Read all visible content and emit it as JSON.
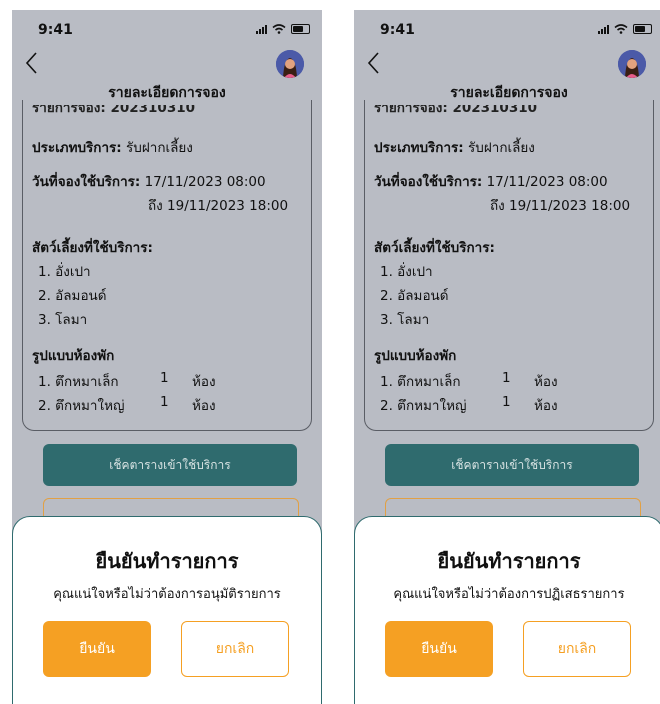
{
  "status": {
    "time": "9:41"
  },
  "header": {
    "title": "รายละเอียดการจอง"
  },
  "booking": {
    "partial_line": "รายการจอง: 202310310",
    "service_type_label": "ประเภทบริการ:",
    "service_type_value": "รับฝากเลี้ยง",
    "date_label": "วันที่จองใช้บริการ:",
    "date_from": "17/11/2023 08:00",
    "date_to": "ถึง 19/11/2023 18:00",
    "pets_label": "สัตว์เลี้ยงที่ใช้บริการ:",
    "pets": [
      "1. อั่งเปา",
      "2. อัลมอนด์",
      "3. โลมา"
    ],
    "rooms_label": "รูปแบบห้องพัก",
    "rooms": [
      {
        "name": "1. ตึกหมาเล็ก",
        "count": "1",
        "unit": "ห้อง"
      },
      {
        "name": "2. ตึกหมาใหญ่",
        "count": "1",
        "unit": "ห้อง"
      }
    ]
  },
  "buttons": {
    "check_schedule": "เช็คตารางเข้าใช้บริการ"
  },
  "dialog_left": {
    "title": "ยืนยันทำรายการ",
    "message": "คุณแน่ใจหรือไม่ว่าต้องการอนุมัติรายการ",
    "confirm": "ยืนยัน",
    "cancel": "ยกเลิก"
  },
  "dialog_right": {
    "title": "ยืนยันทำรายการ",
    "message": "คุณแน่ใจหรือไม่ว่าต้องการปฏิเสธรายการ",
    "confirm": "ยืนยัน",
    "cancel": "ยกเลิก"
  },
  "colors": {
    "overlay": "#b9bcc4",
    "primary": "#2f6b6e",
    "accent": "#f5a023"
  }
}
